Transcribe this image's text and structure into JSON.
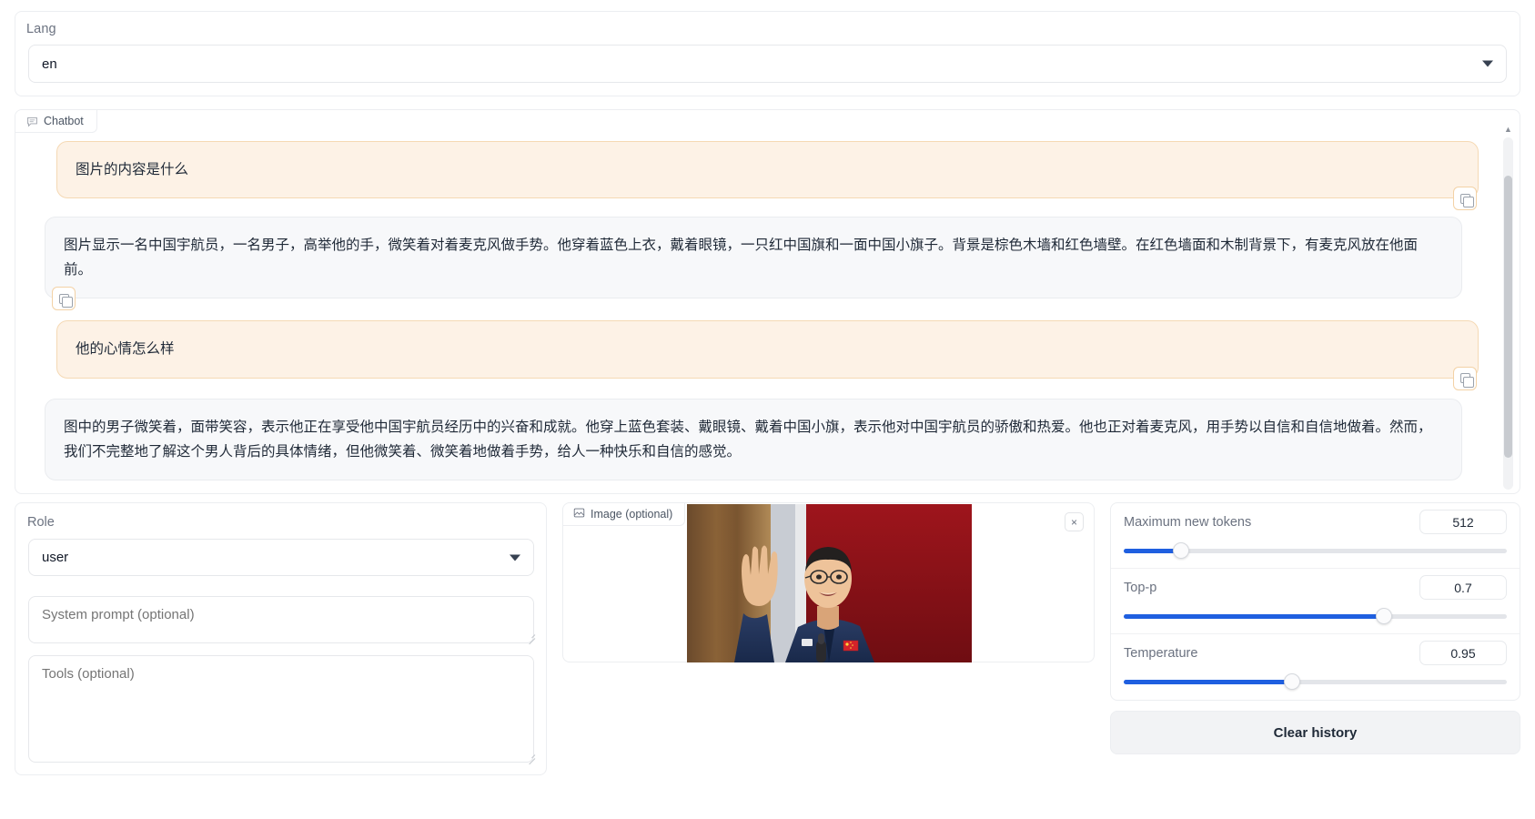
{
  "lang": {
    "label": "Lang",
    "value": "en"
  },
  "chatbot": {
    "tab_label": "Chatbot",
    "messages": [
      {
        "role": "user",
        "text": "图片的内容是什么"
      },
      {
        "role": "assistant",
        "text": "图片显示一名中国宇航员，一名男子，高举他的手，微笑着对着麦克风做手势。他穿着蓝色上衣，戴着眼镜，一只红中国旗和一面中国小旗子。背景是棕色木墙和红色墙壁。在红色墙面和木制背景下，有麦克风放在他面前。"
      },
      {
        "role": "user",
        "text": "他的心情怎么样"
      },
      {
        "role": "assistant",
        "text": "图中的男子微笑着，面带笑容，表示他正在享受他中国宇航员经历中的兴奋和成就。他穿上蓝色套装、戴眼镜、戴着中国小旗，表示他对中国宇航员的骄傲和热爱。他也正对着麦克风，用手势以自信和自信地做着。然而，我们不完整地了解这个男人背后的具体情绪，但他微笑着、微笑着地做着手势，给人一种快乐和自信的感觉。"
      }
    ],
    "copy_icon": "copy-icon",
    "scroll_up_icon": "▲",
    "scroll_down_icon": "▼"
  },
  "left_panel": {
    "role_label": "Role",
    "role_value": "user",
    "system_prompt_placeholder": "System prompt (optional)",
    "system_prompt_value": "",
    "tools_placeholder": "Tools (optional)",
    "tools_value": ""
  },
  "image_panel": {
    "tab_label": "Image (optional)",
    "close_label": "×",
    "image_icon": "image-icon"
  },
  "params": [
    {
      "name": "Maximum new tokens",
      "value": "512",
      "fill_pct": 15
    },
    {
      "name": "Top-p",
      "value": "0.7",
      "fill_pct": 68
    },
    {
      "name": "Temperature",
      "value": "0.95",
      "fill_pct": 44
    }
  ],
  "actions": {
    "clear_history": "Clear history"
  },
  "colors": {
    "accent": "#1f5fe0",
    "user_bubble_bg": "#fdf2e6",
    "user_bubble_border": "#f5d9b4",
    "bot_bubble_bg": "#f7f8fa",
    "bot_bubble_border": "#eaecef"
  }
}
